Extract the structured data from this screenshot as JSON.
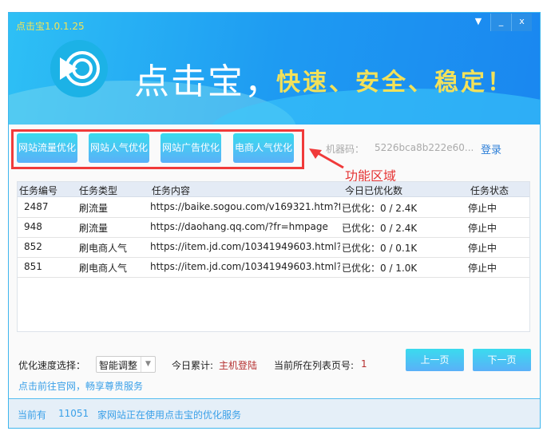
{
  "window": {
    "title": "点击宝1.0.1.25",
    "controls": {
      "menu": "▼",
      "minimize": "_",
      "close": "x"
    }
  },
  "banner": {
    "brand": "点击宝，",
    "slogan": "快速、安全、稳定！"
  },
  "function_buttons": [
    "网站流量优化",
    "网站人气优化",
    "网站广告优化",
    "电商人气优化"
  ],
  "machine_code": {
    "label": "机器码：",
    "value": "5226bca8b222e60...",
    "login": "登录"
  },
  "annotation": "功能区域",
  "table": {
    "headers": [
      "任务编号",
      "任务类型",
      "任务内容",
      "今日已优化数",
      "任务状态"
    ],
    "rows": [
      [
        "2487",
        "刷流量",
        "https://baike.sogou.com/v169321.htm?f",
        "已优化：0 / 2.4K",
        "停止中"
      ],
      [
        "948",
        "刷流量",
        "https://daohang.qq.com/?fr=hmpage",
        "已优化：0 / 2.4K",
        "停止中"
      ],
      [
        "852",
        "刷电商人气",
        "https://item.jd.com/10341949603.html?j",
        "已优化：0 / 0.1K",
        "停止中"
      ],
      [
        "851",
        "刷电商人气",
        "https://item.jd.com/10341949603.html?j",
        "已优化：0 / 1.0K",
        "停止中"
      ]
    ]
  },
  "footer": {
    "speed_label": "优化速度选择：",
    "speed_value": "智能调整",
    "today_label": "今日累计:",
    "today_value": "主机登陆",
    "page_label": "当前所在列表页号:",
    "page_value": "1",
    "prev": "上一页",
    "next": "下一页",
    "link": "点击前往官网，畅享尊贵服务"
  },
  "status": {
    "prefix": "当前有",
    "count": "11051",
    "suffix": "家网站正在使用点击宝的优化服务"
  },
  "colors": {
    "accent": "#1e9bf2",
    "highlight": "#f03a3a",
    "slogan": "#f2e15a"
  }
}
